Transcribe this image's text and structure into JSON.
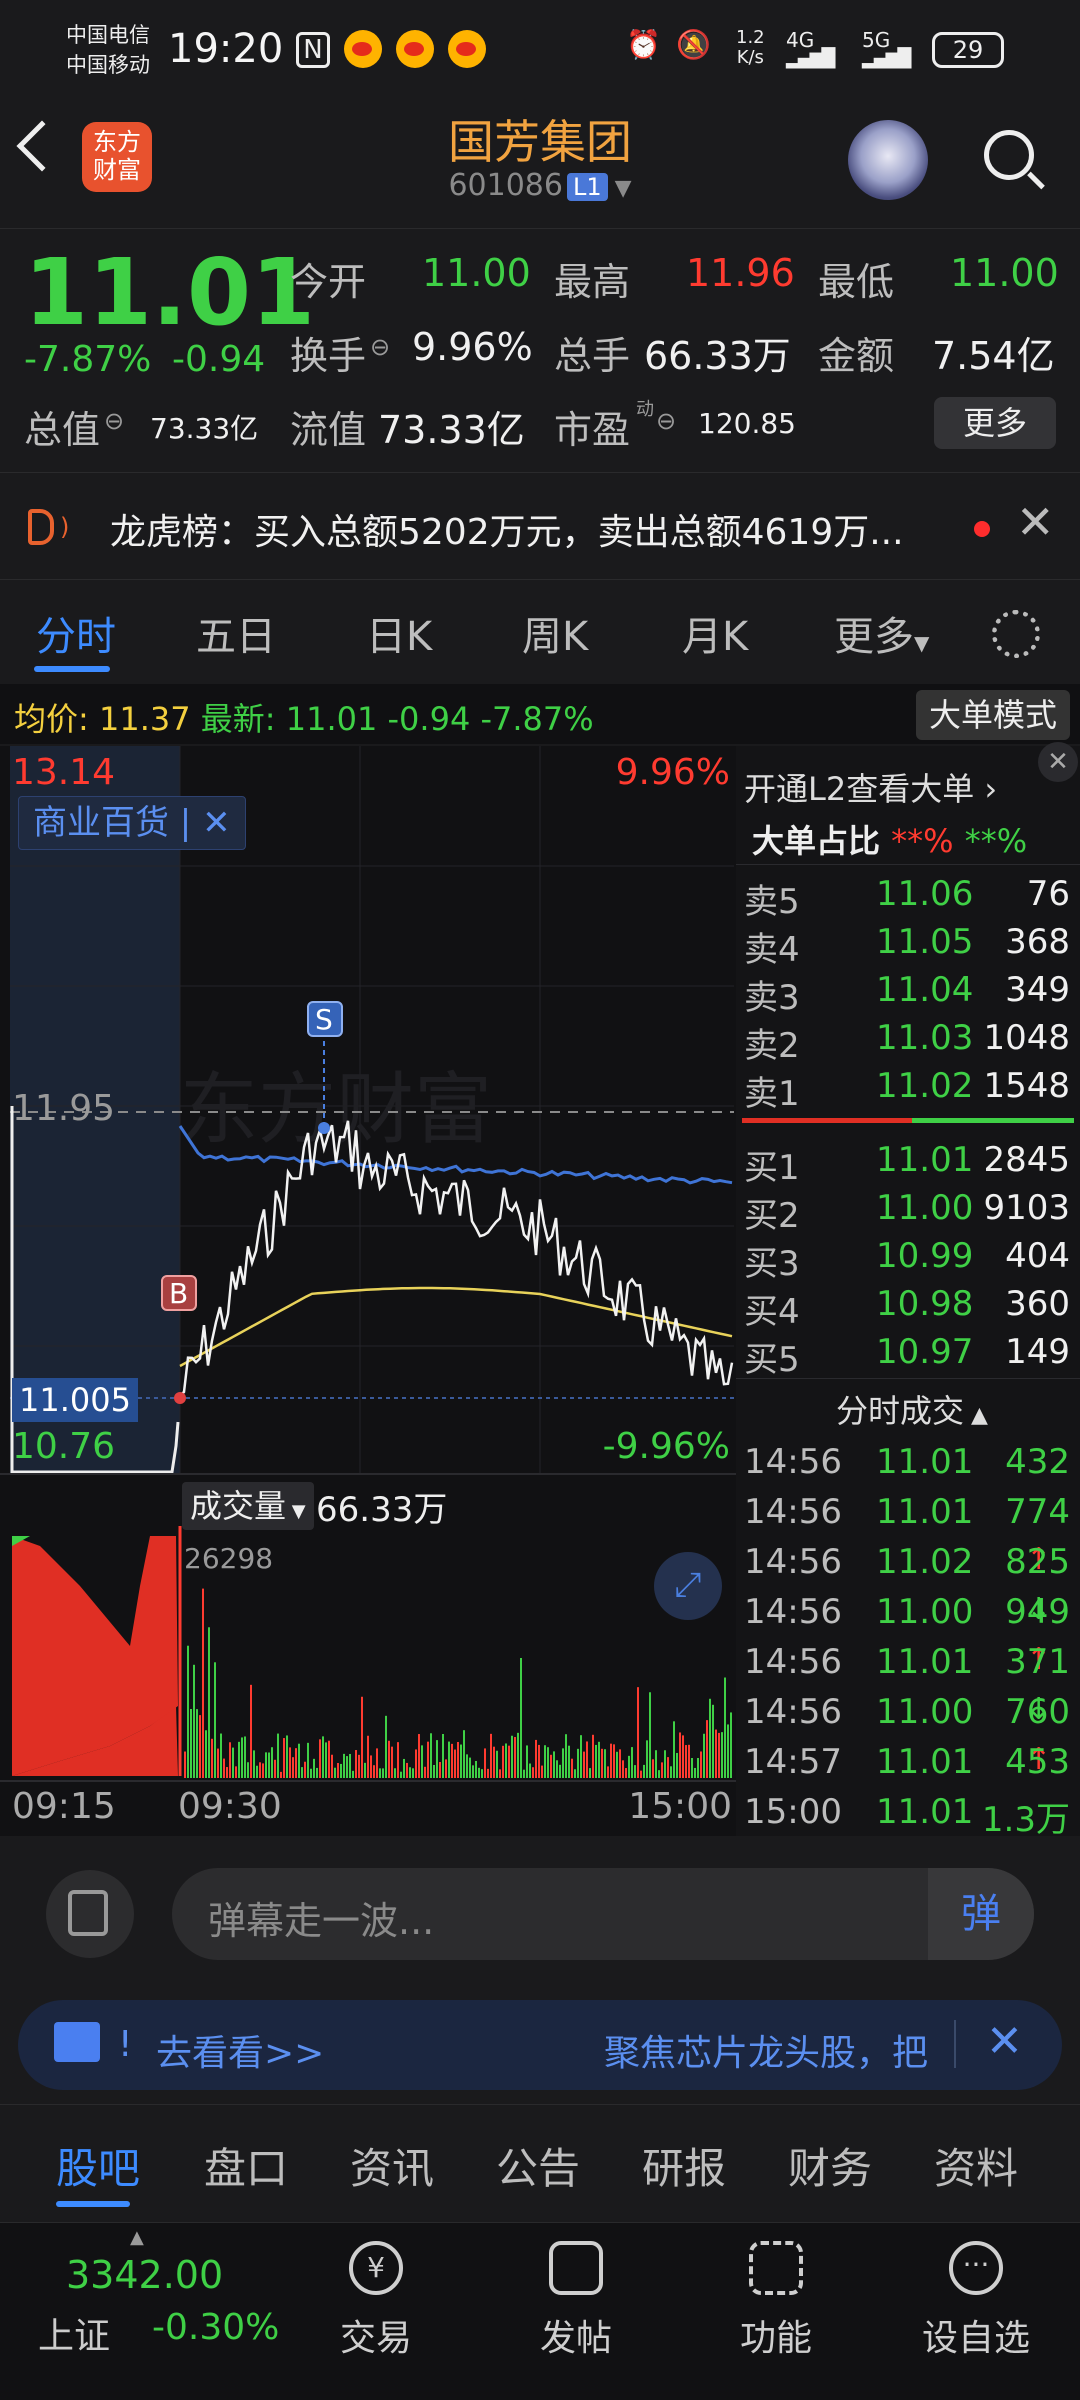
{
  "status_bar": {
    "carrier1": "中国电信",
    "carrier2": "中国移动",
    "time": "19:20",
    "net_speed_top": "1.2",
    "net_speed_bottom": "K/s",
    "net1": "4G",
    "net2": "5G",
    "battery": "29"
  },
  "header": {
    "logo_text_1": "东方",
    "logo_text_2": "财富",
    "title": "国芳集团",
    "stock_code": "601086",
    "level_badge": "L1"
  },
  "quote": {
    "last_price": "11.01",
    "change_pct": "-7.87%",
    "change_amt": "-0.94",
    "open_label": "今开",
    "open_value": "11.00",
    "high_label": "最高",
    "high_value": "11.96",
    "low_label": "最低",
    "low_value": "11.00",
    "turnover_label": "换手",
    "turnover_value": "9.96%",
    "volume_label": "总手",
    "volume_value": "66.33万",
    "amount_label": "金额",
    "amount_value": "7.54亿",
    "mktcap_label": "总值",
    "mktcap_value": "73.33亿",
    "float_label": "流值",
    "float_value": "73.33亿",
    "pe_label": "市盈",
    "pe_sup": "动",
    "pe_value": "120.85",
    "more_button": "更多"
  },
  "notice": {
    "text": "龙虎榜：买入总额5202万元，卖出总额4619万..."
  },
  "tabs": [
    {
      "label": "分时",
      "active": true
    },
    {
      "label": "五日"
    },
    {
      "label": "日K"
    },
    {
      "label": "周K"
    },
    {
      "label": "月K"
    },
    {
      "label": "更多"
    }
  ],
  "info_line": {
    "avg_label": "均价:",
    "avg_value": "11.37",
    "latest_label": "最新:",
    "latest_value": "11.01",
    "change": "-0.94",
    "change_pct": "-7.87%",
    "mode_button": "大单模式"
  },
  "chart": {
    "top_price": "13.14",
    "top_pct": "9.96%",
    "ref_price": "11.95",
    "current_price_label": "11.005",
    "bottom_price": "10.76",
    "bottom_pct": "-9.96%",
    "sector_tag": "商业百货 |",
    "buy_marker": "B",
    "sell_marker": "S",
    "watermark": "东方财富",
    "volume_label": "成交量",
    "volume_total": "66.33万",
    "volume_max": "26298",
    "time_start": "09:15",
    "time_open": "09:30",
    "time_end": "15:00",
    "colors": {
      "price_line": "#f2f2f2",
      "avg_line": "#e8d25a",
      "blue_line": "#3f74d6",
      "up": "#ff3b30",
      "down": "#3fd046"
    }
  },
  "order_book": {
    "header": "开通L2查看大单",
    "ratio_label": "大单占比",
    "ratio_red": "**%",
    "ratio_green": "**%",
    "asks": [
      {
        "label": "卖5",
        "price": "11.06",
        "vol": "76"
      },
      {
        "label": "卖4",
        "price": "11.05",
        "vol": "368"
      },
      {
        "label": "卖3",
        "price": "11.04",
        "vol": "349"
      },
      {
        "label": "卖2",
        "price": "11.03",
        "vol": "1048"
      },
      {
        "label": "卖1",
        "price": "11.02",
        "vol": "1548"
      }
    ],
    "bids": [
      {
        "label": "买1",
        "price": "11.01",
        "vol": "2845"
      },
      {
        "label": "买2",
        "price": "11.00",
        "vol": "9103"
      },
      {
        "label": "买3",
        "price": "10.99",
        "vol": "404"
      },
      {
        "label": "买4",
        "price": "10.98",
        "vol": "360"
      },
      {
        "label": "买5",
        "price": "10.97",
        "vol": "149"
      }
    ],
    "trades_header": "分时成交",
    "trades": [
      {
        "time": "14:56",
        "price": "11.01",
        "vol": "432",
        "arrow": ""
      },
      {
        "time": "14:56",
        "price": "11.01",
        "vol": "774",
        "arrow": ""
      },
      {
        "time": "14:56",
        "price": "11.02",
        "vol": "825",
        "arrow": "↑"
      },
      {
        "time": "14:56",
        "price": "11.00",
        "vol": "949",
        "arrow": "↓"
      },
      {
        "time": "14:56",
        "price": "11.01",
        "vol": "371",
        "arrow": "↑"
      },
      {
        "time": "14:56",
        "price": "11.00",
        "vol": "760",
        "arrow": "↓"
      },
      {
        "time": "14:57",
        "price": "11.01",
        "vol": "453",
        "arrow": "↑"
      },
      {
        "time": "15:00",
        "price": "11.01",
        "vol": "1.3万",
        "arrow": ""
      }
    ]
  },
  "comment": {
    "placeholder": "弹幕走一波...",
    "danmu_button": "弹"
  },
  "ad": {
    "left_text": "去看看>>",
    "right_text": "聚焦芯片龙头股，把"
  },
  "sub_tabs": [
    {
      "label": "股吧",
      "active": true
    },
    {
      "label": "盘口"
    },
    {
      "label": "资讯"
    },
    {
      "label": "公告"
    },
    {
      "label": "研报"
    },
    {
      "label": "财务"
    },
    {
      "label": "资料"
    }
  ],
  "bottom_nav": {
    "index_value": "3342.00",
    "index_name": "上证",
    "index_change": "-0.30%",
    "items": [
      {
        "label": "交易"
      },
      {
        "label": "发帖"
      },
      {
        "label": "功能"
      },
      {
        "label": "设自选"
      }
    ]
  }
}
